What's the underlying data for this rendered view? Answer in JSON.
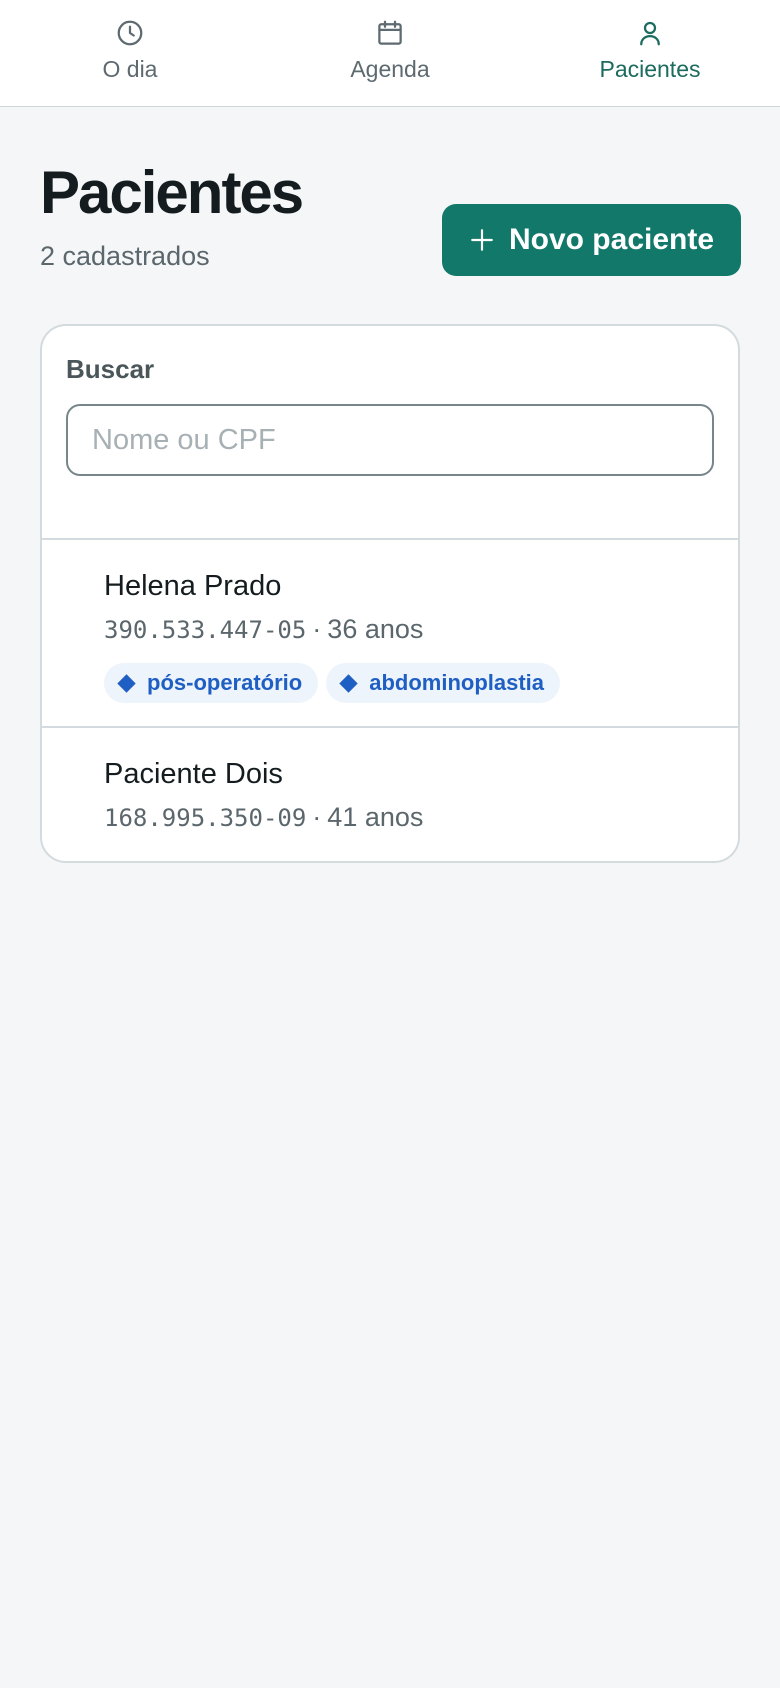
{
  "nav": {
    "items": [
      {
        "label": "O dia",
        "icon": "clock-icon"
      },
      {
        "label": "Agenda",
        "icon": "calendar-icon"
      },
      {
        "label": "Pacientes",
        "icon": "person-icon",
        "active": true
      }
    ]
  },
  "header": {
    "title": "Pacientes",
    "subtitle": "2 cadastrados",
    "new_button_label": "Novo paciente",
    "new_button_icon": "plus-icon"
  },
  "search": {
    "label": "Buscar",
    "placeholder": "Nome ou CPF",
    "value": ""
  },
  "patients": [
    {
      "name": "Helena Prado",
      "cpf": "390.533.447-05",
      "separator": "·",
      "age": "36 anos",
      "tags": [
        "pós-operatório",
        "abdominoplastia"
      ]
    },
    {
      "name": "Paciente Dois",
      "cpf": "168.995.350-09",
      "separator": "·",
      "age": "41 anos",
      "tags": []
    }
  ],
  "colors": {
    "brand": "#12786a",
    "active_nav": "#1b6b5e",
    "tag_text": "#1f5fc4",
    "tag_bg": "#eef4fb",
    "background": "#f4f6f8"
  }
}
